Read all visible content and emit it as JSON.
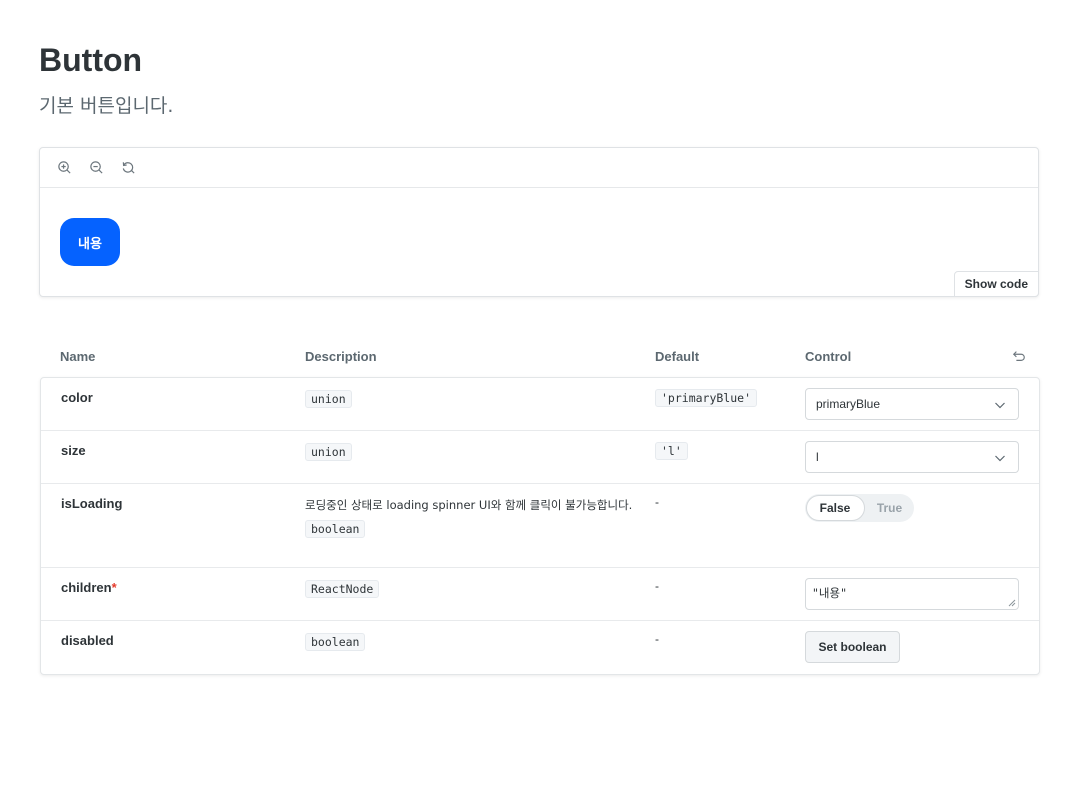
{
  "page": {
    "title": "Button",
    "subtitle": "기본 버튼입니다."
  },
  "preview": {
    "toolbar": [
      {
        "icon": "zoom-in-icon"
      },
      {
        "icon": "zoom-out-icon"
      },
      {
        "icon": "zoom-reset-icon"
      }
    ],
    "demo_button_label": "내용",
    "demo_button_color": "#0562ff",
    "show_code_label": "Show code"
  },
  "args_table": {
    "headers": {
      "name": "Name",
      "description": "Description",
      "default": "Default",
      "control": "Control"
    },
    "rows": [
      {
        "name": "color",
        "required": "",
        "description": "",
        "type": "union",
        "default": "'primaryBlue'",
        "control": {
          "kind": "select",
          "value": "primaryBlue"
        }
      },
      {
        "name": "size",
        "required": "",
        "description": "",
        "type": "union",
        "default": "'l'",
        "control": {
          "kind": "select",
          "value": "l"
        }
      },
      {
        "name": "isLoading",
        "required": "",
        "description": "로딩중인 상태로 loading spinner UI와 함께 클릭이 불가능합니다.",
        "type": "boolean",
        "default": "-",
        "control": {
          "kind": "toggle",
          "false_label": "False",
          "true_label": "True",
          "value": false
        }
      },
      {
        "name": "children",
        "required": "*",
        "description": "",
        "type": "ReactNode",
        "default": "-",
        "control": {
          "kind": "textarea",
          "value": "\"내용\""
        }
      },
      {
        "name": "disabled",
        "required": "",
        "description": "",
        "type": "boolean",
        "default": "-",
        "control": {
          "kind": "button",
          "label": "Set boolean"
        }
      }
    ]
  }
}
